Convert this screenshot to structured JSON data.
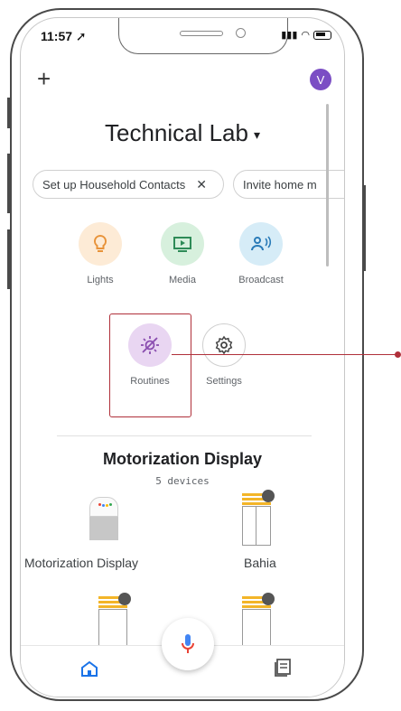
{
  "status_bar": {
    "time": "11:57"
  },
  "header": {
    "add_label": "+",
    "avatar_initial": "V"
  },
  "home": {
    "title": "Technical Lab",
    "dropdown_caret": "▾"
  },
  "chips": [
    {
      "label": "Set up Household Contacts",
      "close": "✕"
    },
    {
      "label": "Invite home m"
    }
  ],
  "actions": [
    {
      "label": "Lights"
    },
    {
      "label": "Media"
    },
    {
      "label": "Broadcast"
    },
    {
      "label": "Routines"
    },
    {
      "label": "Settings"
    }
  ],
  "room": {
    "title": "Motorization Display",
    "subtitle": "5 devices"
  },
  "devices": [
    {
      "label": "Motorization Display"
    },
    {
      "label": "Bahia"
    }
  ],
  "colors": {
    "lights_bg": "#fdebd6",
    "lights_icon": "#e8933a",
    "media_bg": "#d7f0dd",
    "media_icon": "#2e8b57",
    "broadcast_bg": "#d6ecf7",
    "broadcast_icon": "#2a7bb8",
    "routines_bg": "#e9d6f2",
    "routines_icon": "#8b4fb0",
    "highlight": "#b0303a",
    "avatar": "#7b4ec4",
    "accent_blue": "#1a73e8"
  },
  "icons": [
    "add-icon",
    "avatar",
    "lightbulb-icon",
    "media-icon",
    "broadcast-icon",
    "routines-icon",
    "gear-icon",
    "smart-speaker-icon",
    "blind-icon",
    "mic-icon",
    "home-icon",
    "list-icon"
  ]
}
